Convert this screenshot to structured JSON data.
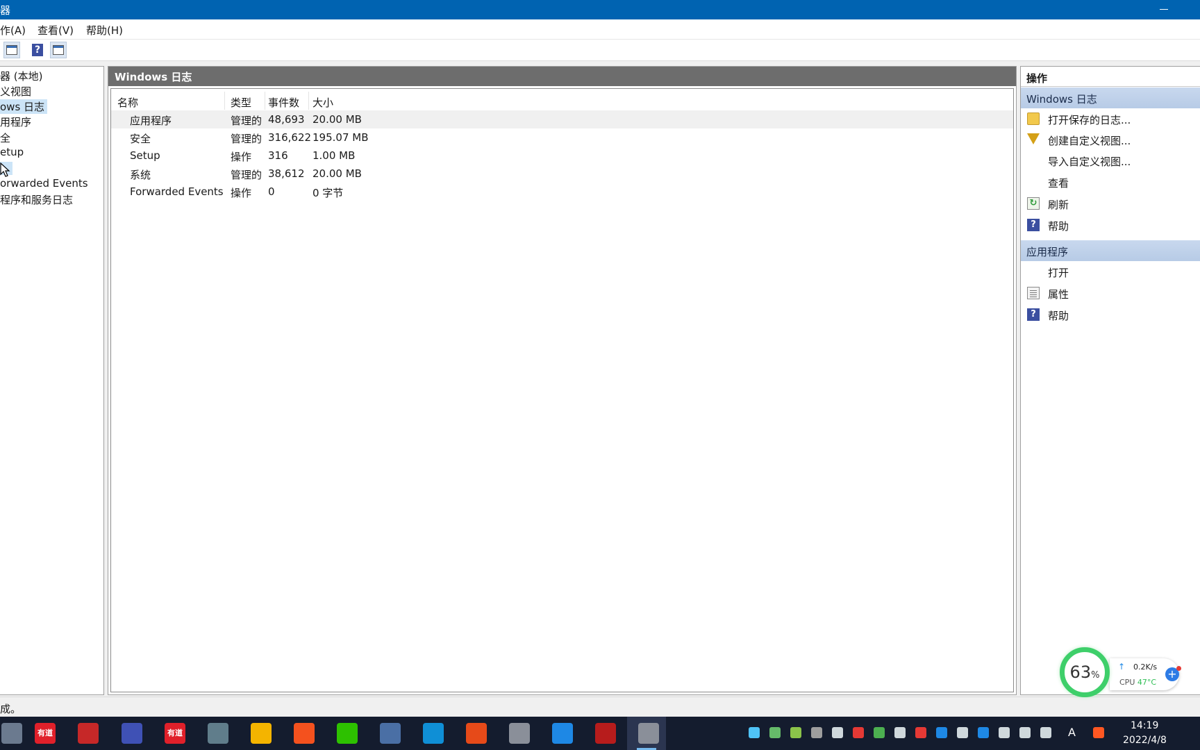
{
  "window": {
    "title_fragment": "器"
  },
  "menu": [
    {
      "label": "作(A)"
    },
    {
      "label": "查看(V)"
    },
    {
      "label": "帮助(H)"
    }
  ],
  "tree": {
    "items": [
      {
        "label": "器 (本地)"
      },
      {
        "label": "义视图"
      },
      {
        "label": "ows 日志",
        "selected": true
      },
      {
        "label": "用程序"
      },
      {
        "label": "全"
      },
      {
        "label": "etup"
      },
      {
        "label": ""
      },
      {
        "label": "orwarded Events"
      },
      {
        "label": "程序和服务日志"
      }
    ]
  },
  "center": {
    "title": "Windows 日志",
    "columns": [
      "名称",
      "类型",
      "事件数",
      "大小"
    ],
    "rows": [
      {
        "name": "应用程序",
        "type": "管理的",
        "count": "48,693",
        "size": "20.00 MB"
      },
      {
        "name": "安全",
        "type": "管理的",
        "count": "316,622",
        "size": "195.07 MB"
      },
      {
        "name": "Setup",
        "type": "操作",
        "count": "316",
        "size": "1.00 MB"
      },
      {
        "name": "系统",
        "type": "管理的",
        "count": "38,612",
        "size": "20.00 MB"
      },
      {
        "name": "Forwarded Events",
        "type": "操作",
        "count": "0",
        "size": "0 字节"
      }
    ]
  },
  "actions": {
    "title": "操作",
    "section1": {
      "title": "Windows 日志",
      "items": [
        {
          "label": "打开保存的日志...",
          "icon": "folder-open-icon"
        },
        {
          "label": "创建自定义视图...",
          "icon": "filter-icon"
        },
        {
          "label": "导入自定义视图...",
          "icon": ""
        },
        {
          "label": "查看",
          "icon": ""
        },
        {
          "label": "刷新",
          "icon": "refresh-icon"
        },
        {
          "label": "帮助",
          "icon": "help-icon"
        }
      ]
    },
    "section2": {
      "title": "应用程序",
      "items": [
        {
          "label": "打开",
          "icon": ""
        },
        {
          "label": "属性",
          "icon": "properties-icon"
        },
        {
          "label": "帮助",
          "icon": "help-icon"
        }
      ]
    }
  },
  "status": {
    "text": "成。"
  },
  "monitor": {
    "percent_value": "63",
    "percent_unit": "%",
    "net_speed": "0.2K/s",
    "cpu_label": "CPU",
    "cpu_temp": "47°C"
  },
  "taskbar": {
    "apps": [
      {
        "icon": "tool-icon",
        "color": "#6b7a8f",
        "text": ""
      },
      {
        "icon": "youdao-icon",
        "color": "#e0202a",
        "text": "有道"
      },
      {
        "icon": "calendar-icon",
        "color": "#c62828",
        "text": ""
      },
      {
        "icon": "save-disk-icon",
        "color": "#3f51b5",
        "text": ""
      },
      {
        "icon": "youdao-icon",
        "color": "#e0202a",
        "text": "有道"
      },
      {
        "icon": "calculator-icon",
        "color": "#607d8b",
        "text": ""
      },
      {
        "icon": "folder-icon",
        "color": "#f4b400",
        "text": ""
      },
      {
        "icon": "feather-app-icon",
        "color": "#f4511e",
        "text": ""
      },
      {
        "icon": "wechat-icon",
        "color": "#2dc100",
        "text": ""
      },
      {
        "icon": "network-computer-icon",
        "color": "#4a6fa5",
        "text": ""
      },
      {
        "icon": "edge-icon",
        "color": "#0f8fd6",
        "text": ""
      },
      {
        "icon": "x-app-icon",
        "color": "#e64a19",
        "text": ""
      },
      {
        "icon": "event-log-icon",
        "color": "#8a8f99",
        "text": ""
      },
      {
        "icon": "feishu-icon",
        "color": "#1e88e5",
        "text": ""
      },
      {
        "icon": "record-icon",
        "color": "#b71c1c",
        "text": ""
      },
      {
        "icon": "event-viewer-icon",
        "color": "#8a8f99",
        "text": "",
        "active": true
      }
    ],
    "tray_icons": [
      "search-circle-icon",
      "shield-icon",
      "add-circle-icon",
      "arrow-icon",
      "transfer-icon",
      "app-red-icon",
      "wechat-tray-icon",
      "volume-icon",
      "security-alert-icon",
      "feishu-tray-icon",
      "battery-icon",
      "display-icon",
      "microphone-icon",
      "globe-icon",
      "keyboard-icon",
      "sogou-icon"
    ],
    "ime": "A",
    "time": "14:19",
    "date": "2022/4/8"
  }
}
